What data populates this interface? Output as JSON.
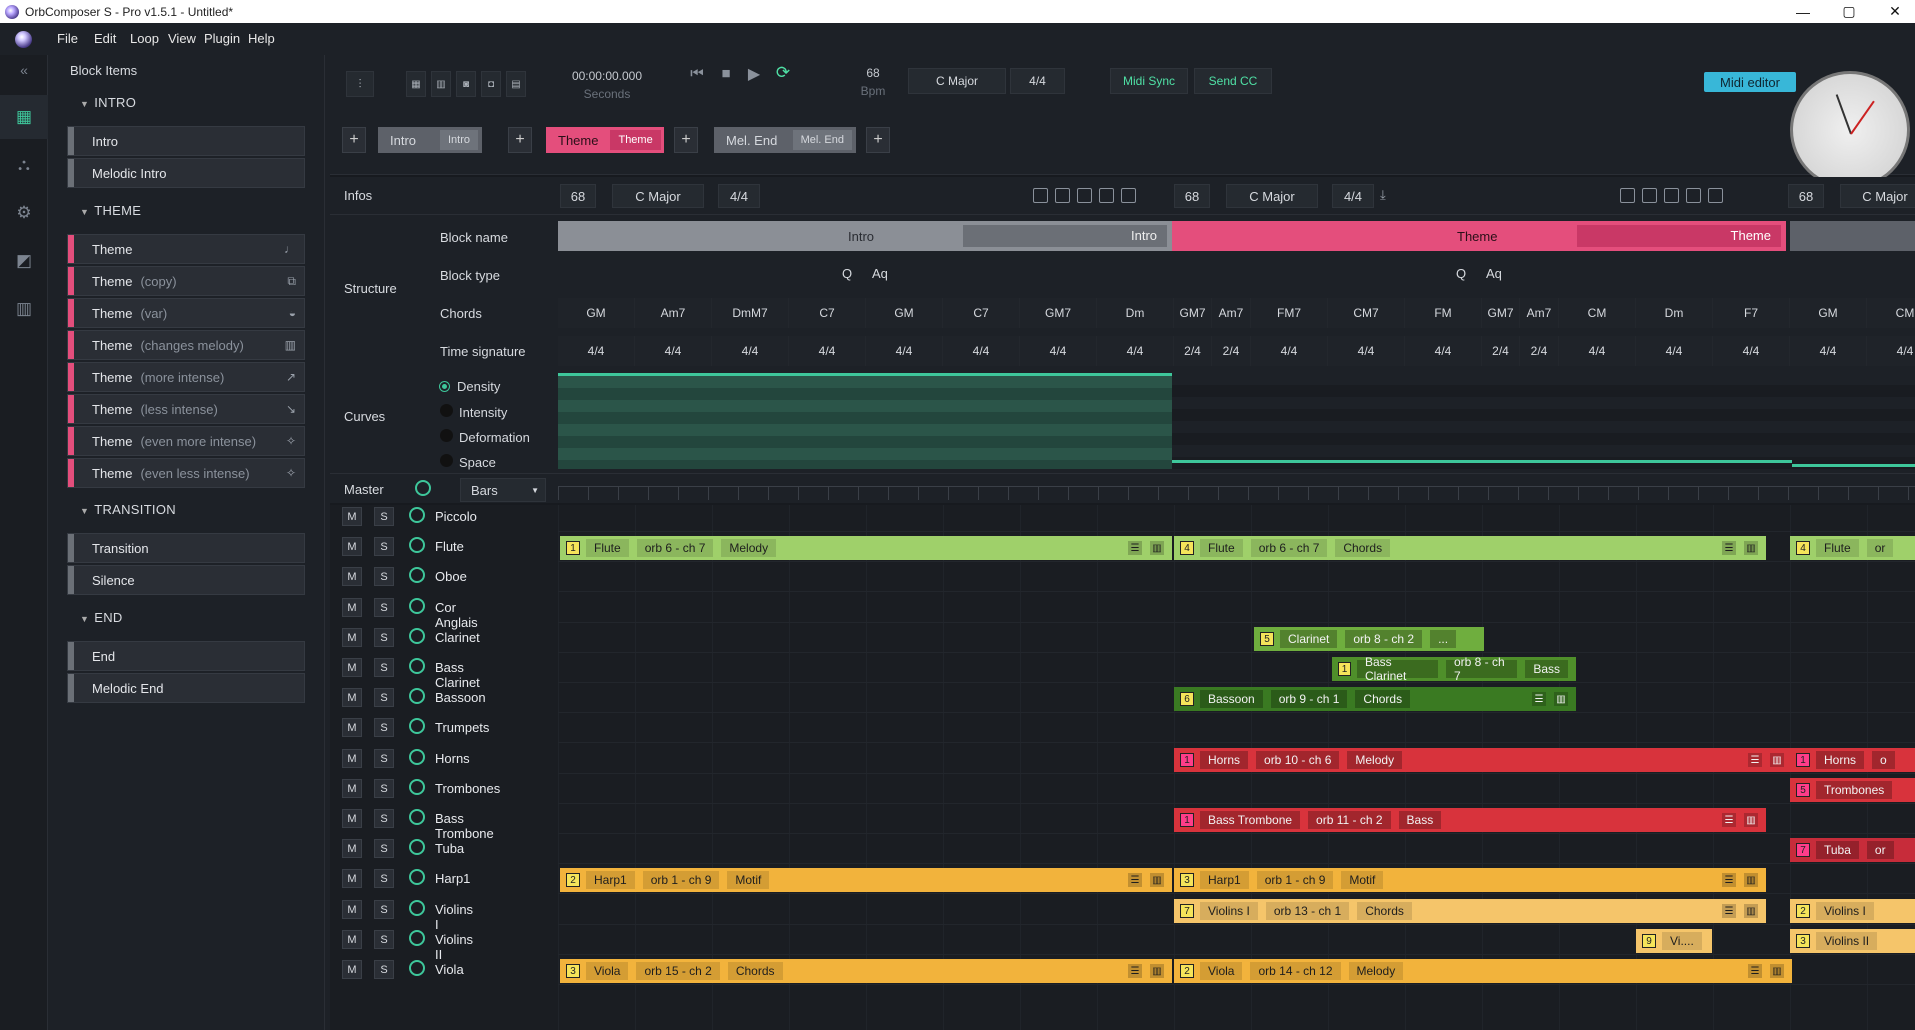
{
  "window": {
    "title": "OrbComposer S - Pro v1.5.1 - Untitled*",
    "minimize": "—",
    "maximize": "▢",
    "close": "✕"
  },
  "menu": [
    "File",
    "Edit",
    "Loop",
    "View",
    "Plugin",
    "Help"
  ],
  "sidebar": {
    "title": "Block Items",
    "sections": [
      {
        "name": "INTRO",
        "items": [
          {
            "label": "Intro",
            "sub": ""
          },
          {
            "label": "Melodic Intro",
            "sub": ""
          }
        ]
      },
      {
        "name": "THEME",
        "items": [
          {
            "label": "Theme",
            "sub": ""
          },
          {
            "label": "Theme",
            "sub": "(copy)"
          },
          {
            "label": "Theme",
            "sub": "(var)"
          },
          {
            "label": "Theme",
            "sub": "(changes melody)"
          },
          {
            "label": "Theme",
            "sub": "(more intense)"
          },
          {
            "label": "Theme",
            "sub": "(less intense)"
          },
          {
            "label": "Theme",
            "sub": "(even more intense)"
          },
          {
            "label": "Theme",
            "sub": "(even less intense)"
          }
        ]
      },
      {
        "name": "TRANSITION",
        "items": [
          {
            "label": "Transition",
            "sub": ""
          },
          {
            "label": "Silence",
            "sub": ""
          }
        ]
      },
      {
        "name": "END",
        "items": [
          {
            "label": "End",
            "sub": ""
          },
          {
            "label": "Melodic End",
            "sub": ""
          }
        ]
      }
    ]
  },
  "toolbar": {
    "time": "00:00:00.000",
    "time_unit": "Seconds",
    "bpm": "68",
    "bpm_unit": "Bpm",
    "key": "C Major",
    "timesig": "4/4",
    "midi_sync": "Midi Sync",
    "send_cc": "Send CC",
    "midi_editor": "Midi editor"
  },
  "blocks": [
    {
      "label": "Intro",
      "tag": "Intro",
      "color": "#5d6169",
      "tagcolor": "#6e737b"
    },
    {
      "label": "Theme",
      "tag": "Theme",
      "color": "#e44e7c",
      "tagcolor": "#c93866"
    },
    {
      "label": "Mel. End",
      "tag": "Mel. End",
      "color": "#5d6169",
      "tagcolor": "#6e737b"
    }
  ],
  "infos": {
    "label": "Infos",
    "blocks": [
      {
        "bpm": "68",
        "key": "C Major",
        "ts": "4/4"
      },
      {
        "bpm": "68",
        "key": "C Major",
        "ts": "4/4"
      },
      {
        "bpm": "68",
        "key": "C Major"
      }
    ]
  },
  "structure": {
    "label": "Structure",
    "rows": [
      "Block name",
      "Block type",
      "Chords",
      "Time signature"
    ],
    "block_names": [
      {
        "name": "Intro",
        "tag": "Intro"
      },
      {
        "name": "Theme",
        "tag": "Theme"
      }
    ],
    "block_type_marks": [
      "Q",
      "Aq"
    ],
    "chords": [
      "GM",
      "Am7",
      "DmM7",
      "C7",
      "GM",
      "C7",
      "GM7",
      "Dm",
      "GM7",
      "Am7",
      "FM7",
      "CM7",
      "FM",
      "GM7",
      "Am7",
      "CM",
      "Dm",
      "F7",
      "GM",
      "CM"
    ],
    "timesigs": [
      "4/4",
      "4/4",
      "4/4",
      "4/4",
      "4/4",
      "4/4",
      "4/4",
      "4/4",
      "2/4",
      "2/4",
      "4/4",
      "4/4",
      "4/4",
      "2/4",
      "2/4",
      "4/4",
      "4/4",
      "4/4",
      "4/4",
      "4/4"
    ]
  },
  "curves": {
    "label": "Curves",
    "options": [
      "Density",
      "Intensity",
      "Deformation",
      "Space"
    ]
  },
  "master": {
    "label": "Master",
    "unit": "Bars"
  },
  "track_buttons": {
    "mute": "M",
    "solo": "S"
  },
  "tracks": [
    "Piccolo",
    "Flute",
    "Oboe",
    "Cor Anglais",
    "Clarinet",
    "Bass Clarinet",
    "Bassoon",
    "Trumpets",
    "Horns",
    "Trombones",
    "Bass Trombone",
    "Tuba",
    "Harp1",
    "Violins I",
    "Violins II",
    "Viola"
  ],
  "clips": [
    {
      "track": 1,
      "num": "1",
      "name": "Flute",
      "orb": "orb 6 - ch 7",
      "role": "Melody",
      "color": "#9fd06a"
    },
    {
      "track": 1,
      "num": "4",
      "name": "Flute",
      "orb": "orb 6 - ch 7",
      "role": "Chords",
      "color": "#9fd06a"
    },
    {
      "track": 1,
      "num": "4",
      "name": "Flute",
      "orb": "or",
      "role": "",
      "color": "#9fd06a"
    },
    {
      "track": 4,
      "num": "5",
      "name": "Clarinet",
      "orb": "orb 8 - ch 2",
      "role": "...",
      "color": "#6fae3e"
    },
    {
      "track": 5,
      "num": "1",
      "name": "Bass Clarinet",
      "orb": "orb 8 - ch 7",
      "role": "Bass",
      "color": "#4f8f2a"
    },
    {
      "track": 6,
      "num": "6",
      "name": "Bassoon",
      "orb": "orb 9 - ch 1",
      "role": "Chords",
      "color": "#3a7a22"
    },
    {
      "track": 8,
      "num": "1",
      "name": "Horns",
      "orb": "orb 10 - ch 6",
      "role": "Melody",
      "color": "#d8333c"
    },
    {
      "track": 8,
      "num": "1",
      "name": "Horns",
      "orb": "o",
      "role": "",
      "color": "#d8333c"
    },
    {
      "track": 9,
      "num": "5",
      "name": "Trombones",
      "orb": "",
      "role": "",
      "color": "#d8333c"
    },
    {
      "track": 10,
      "num": "1",
      "name": "Bass Trombone",
      "orb": "orb 11 - ch 2",
      "role": "Bass",
      "color": "#d8333c"
    },
    {
      "track": 11,
      "num": "7",
      "name": "Tuba",
      "orb": "or",
      "role": "",
      "color": "#c72c3a"
    },
    {
      "track": 12,
      "num": "2",
      "name": "Harp1",
      "orb": "orb 1 - ch 9",
      "role": "Motif",
      "color": "#f2b33c"
    },
    {
      "track": 12,
      "num": "3",
      "name": "Harp1",
      "orb": "orb 1 - ch 9",
      "role": "Motif",
      "color": "#f2b33c"
    },
    {
      "track": 13,
      "num": "7",
      "name": "Violins I",
      "orb": "orb 13 - ch 1",
      "role": "Chords",
      "color": "#f5c56a"
    },
    {
      "track": 13,
      "num": "2",
      "name": "Violins I",
      "orb": "",
      "role": "",
      "color": "#f5c56a"
    },
    {
      "track": 14,
      "num": "9",
      "name": "Vi....",
      "orb": "",
      "role": "",
      "color": "#f5c56a"
    },
    {
      "track": 14,
      "num": "3",
      "name": "Violins II",
      "orb": "",
      "role": "",
      "color": "#f5c56a"
    },
    {
      "track": 15,
      "num": "3",
      "name": "Viola",
      "orb": "orb 15 - ch 2",
      "role": "Chords",
      "color": "#f2b33c"
    },
    {
      "track": 15,
      "num": "2",
      "name": "Viola",
      "orb": "orb 14 - ch 12",
      "role": "Melody",
      "color": "#f2b33c"
    }
  ],
  "colors": {
    "accent": "#3ec79b",
    "theme_pink": "#e44e7c",
    "midi_editor": "#38b7d8"
  }
}
